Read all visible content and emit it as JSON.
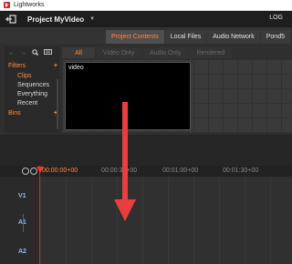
{
  "window": {
    "title": "Lightworks"
  },
  "header": {
    "project_title": "Project MyVideo",
    "caret": "▼",
    "log_label": "LOG",
    "exit_icon": "exit-icon"
  },
  "panel_tabs": [
    "Project Contents",
    "Local Files",
    "Audio Network",
    "Pond5"
  ],
  "panel_tabs_active": "Project Contents",
  "sidebar": {
    "nav_icons": [
      "back-arrow-icon",
      "forward-arrow-icon",
      "search-icon",
      "keyboard-icon"
    ],
    "filters_label": "Filters",
    "bins_label": "Bins",
    "plus": "+",
    "items": [
      "Clips",
      "Sequences",
      "Everything",
      "Recent"
    ],
    "active_item": "Clips"
  },
  "content_tabs": [
    "All",
    "Video Only",
    "Audio Only",
    "Rendered"
  ],
  "content_tabs_active": "All",
  "clips": [
    {
      "label": "video"
    }
  ],
  "timeline": {
    "timecodes": [
      "00:00:00+00",
      "00:00:30+00",
      "00:01:00+00",
      "00:01:30+00"
    ],
    "tracks": [
      "V1",
      "A1",
      "A2"
    ]
  },
  "colors": {
    "accent": "#ff8a3d",
    "playhead": "#e52020",
    "arrow": "#ea3d3d",
    "track_label": "#9ab6e6"
  }
}
